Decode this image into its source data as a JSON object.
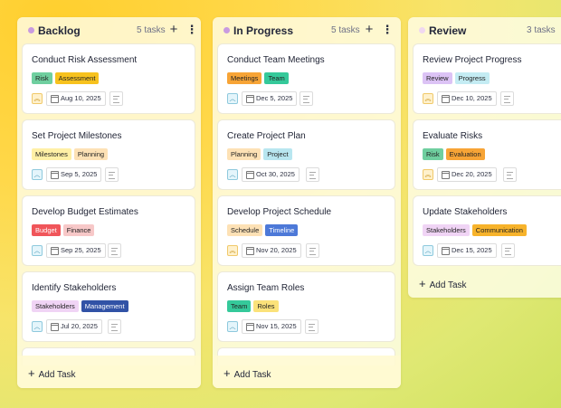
{
  "columns": [
    {
      "title": "Backlog",
      "count": "5 tasks",
      "dot_color": "#c99be0",
      "cards": [
        {
          "title": "Conduct Risk Assessment",
          "tags": [
            {
              "label": "Risk",
              "color": "#6fcf9f"
            },
            {
              "label": "Assessment",
              "color": "#f7c21e"
            }
          ],
          "priority": "high",
          "date": "Aug 10, 2025"
        },
        {
          "title": "Set Project Milestones",
          "tags": [
            {
              "label": "Milestones",
              "color": "#fff0a6"
            },
            {
              "label": "Planning",
              "color": "#fde1b5"
            }
          ],
          "priority": "medium",
          "date": "Sep 5, 2025"
        },
        {
          "title": "Develop Budget Estimates",
          "tags": [
            {
              "label": "Budget",
              "color": "#f0555a"
            },
            {
              "label": "Finance",
              "color": "#f7c8c8"
            }
          ],
          "priority": "medium",
          "date": "Sep 25, 2025"
        },
        {
          "title": "Identify Stakeholders",
          "tags": [
            {
              "label": "Stakeholders",
              "color": "#f0d4f5"
            },
            {
              "label": "Management",
              "color": "#3152a6"
            }
          ],
          "priority": "medium",
          "date": "Jul 20, 2025"
        }
      ],
      "add_label": "Add Task"
    },
    {
      "title": "In Progress",
      "count": "5 tasks",
      "dot_color": "#c99be0",
      "cards": [
        {
          "title": "Conduct Team Meetings",
          "tags": [
            {
              "label": "Meetings",
              "color": "#f7a436"
            },
            {
              "label": "Team",
              "color": "#35c99a"
            }
          ],
          "priority": "medium",
          "date": "Dec 5, 2025"
        },
        {
          "title": "Create Project Plan",
          "tags": [
            {
              "label": "Planning",
              "color": "#fde1b5"
            },
            {
              "label": "Project",
              "color": "#b8e6f0"
            }
          ],
          "priority": "medium",
          "date": "Oct 30, 2025"
        },
        {
          "title": "Develop Project Schedule",
          "tags": [
            {
              "label": "Schedule",
              "color": "#fde1b5"
            },
            {
              "label": "Timeline",
              "color": "#4d79d8"
            }
          ],
          "priority": "high",
          "date": "Nov 20, 2025"
        },
        {
          "title": "Assign Team Roles",
          "tags": [
            {
              "label": "Team",
              "color": "#35c99a"
            },
            {
              "label": "Roles",
              "color": "#fbe27a"
            }
          ],
          "priority": "medium",
          "date": "Nov 15, 2025"
        }
      ],
      "add_label": "Add Task"
    },
    {
      "title": "Review",
      "count": "3 tasks",
      "dot_color": "#f0d8f0",
      "cards": [
        {
          "title": "Review Project Progress",
          "tags": [
            {
              "label": "Review",
              "color": "#dcc3f5"
            },
            {
              "label": "Progress",
              "color": "#c4ecf3"
            }
          ],
          "priority": "high",
          "date": "Dec 10, 2025"
        },
        {
          "title": "Evaluate Risks",
          "tags": [
            {
              "label": "Risk",
              "color": "#6fcf9f"
            },
            {
              "label": "Evaluation",
              "color": "#f7a436"
            }
          ],
          "priority": "high",
          "date": "Dec 20, 2025"
        },
        {
          "title": "Update Stakeholders",
          "tags": [
            {
              "label": "Stakeholders",
              "color": "#f0d4f5"
            },
            {
              "label": "Communication",
              "color": "#f7b32b"
            }
          ],
          "priority": "medium",
          "date": "Dec 15, 2025"
        }
      ],
      "add_label": "Add Task"
    }
  ]
}
